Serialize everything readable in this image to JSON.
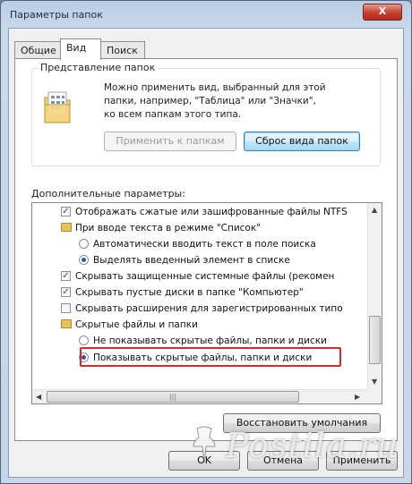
{
  "window": {
    "title": "Параметры папок",
    "close_label": "X"
  },
  "tabs": [
    {
      "label": "Общие"
    },
    {
      "label": "Вид"
    },
    {
      "label": "Поиск"
    }
  ],
  "folder_views": {
    "title": "Представление папок",
    "description_lines": [
      "Можно применить вид, выбранный для этой",
      "папки, например, \"Таблица\" или \"Значки\",",
      "ко всем папкам этого типа."
    ],
    "apply_button": "Применить к папкам",
    "reset_button": "Сброс вида папок"
  },
  "advanced": {
    "label": "Дополнительные параметры:",
    "items": [
      {
        "kind": "checkbox",
        "checked": true,
        "level": 0,
        "text": "Отображать сжатые или зашифрованные файлы NTFS"
      },
      {
        "kind": "folder",
        "level": 0,
        "text": "При вводе текста в режиме \"Список\""
      },
      {
        "kind": "radio",
        "checked": false,
        "level": 1,
        "text": "Автоматически вводить текст в поле поиска"
      },
      {
        "kind": "radio",
        "checked": true,
        "level": 1,
        "text": "Выделять введенный элемент в списке"
      },
      {
        "kind": "checkbox",
        "checked": true,
        "level": 0,
        "text": "Скрывать защищенные системные файлы (рекомен"
      },
      {
        "kind": "checkbox",
        "checked": true,
        "level": 0,
        "text": "Скрывать пустые диски в папке \"Компьютер\""
      },
      {
        "kind": "checkbox",
        "checked": false,
        "level": 0,
        "text": "Скрывать расширения для зарегистрированных типо"
      },
      {
        "kind": "folder",
        "level": 0,
        "text": "Скрытые файлы и папки"
      },
      {
        "kind": "radio",
        "checked": false,
        "level": 1,
        "text": "Не показывать скрытые файлы, папки и диски"
      },
      {
        "kind": "radio",
        "checked": true,
        "level": 1,
        "text": "Показывать скрытые файлы, папки и диски"
      }
    ]
  },
  "restore_button": "Восстановить умолчания",
  "footer": {
    "ok": "OK",
    "cancel": "Отмена",
    "apply": "Применить"
  },
  "watermark": "Postila.ru",
  "colors": {
    "highlight": "#d42a2a",
    "accent": "#3c7fb1"
  }
}
